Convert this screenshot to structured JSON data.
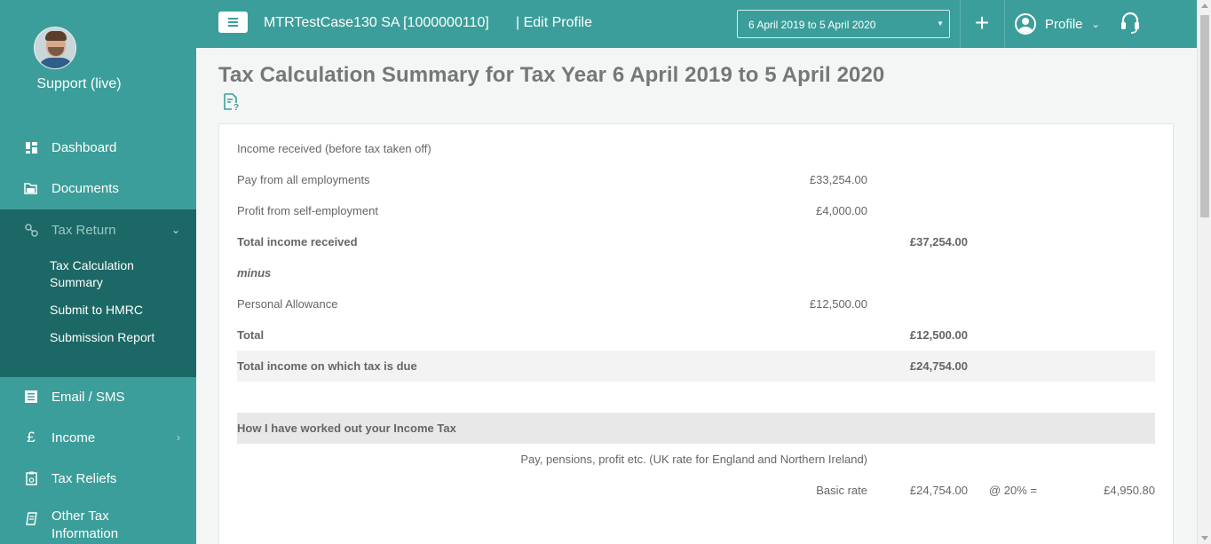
{
  "sidebar": {
    "user_name": "Support (live)",
    "nav": {
      "dashboard": "Dashboard",
      "documents": "Documents",
      "tax_return": "Tax Return",
      "email_sms": "Email / SMS",
      "income": "Income",
      "tax_reliefs": "Tax Reliefs",
      "other_tax": "Other Tax Information"
    },
    "sub_items": [
      "Tax Calculation Summary",
      "Submit to HMRC",
      "Submission Report"
    ]
  },
  "topbar": {
    "client_name": "MTRTestCase130 SA [1000000110]",
    "edit_profile": "| Edit Profile",
    "tax_year": "6 April 2019 to 5 April 2020",
    "profile_label": "Profile"
  },
  "page": {
    "title": "Tax Calculation Summary for Tax Year 6 April 2019 to 5 April 2020"
  },
  "summary": {
    "income_heading": "Income received (before tax taken off)",
    "employment_label": "Pay from all employments",
    "employment_value": "£33,254.00",
    "self_emp_label": "Profit from self-employment",
    "self_emp_value": "£4,000.00",
    "total_income_label": "Total income received",
    "total_income_value": "£37,254.00",
    "minus_label": "minus",
    "allowance_label": "Personal Allowance",
    "allowance_value": "£12,500.00",
    "total_label": "Total",
    "total_value": "£12,500.00",
    "taxable_label": "Total income on which tax is due",
    "taxable_value": "£24,754.00",
    "worked_out_heading": "How I have worked out your Income Tax",
    "pay_pensions_label": "Pay, pensions, profit etc. (UK rate for England and Northern Ireland)",
    "basic_rate_label": "Basic rate",
    "basic_rate_amount": "£24,754.00",
    "basic_rate_pct": "@ 20% =",
    "basic_rate_tax": "£4,950.80"
  },
  "colors": {
    "primary": "#3c9e9a",
    "sidebar_active": "#1c6866"
  }
}
